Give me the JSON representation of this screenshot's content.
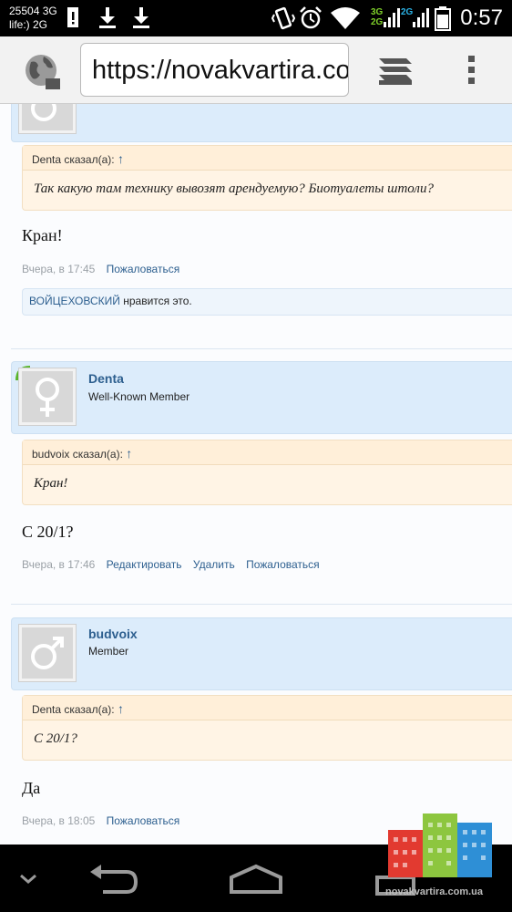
{
  "status_bar": {
    "carrier_line1": "25504 3G",
    "carrier_line2": "life:) 2G",
    "network_badges": [
      "3G",
      "2G",
      "2G"
    ],
    "time": "0:57"
  },
  "browser": {
    "url": "https://novakvartira.com/threads/"
  },
  "posts": [
    {
      "quote_author": "Denta сказал(а):",
      "quote_arrow": "↑",
      "quote_text": "Так какую там технику вывозят арендуемую? Биотуалеты штоли?",
      "message": "Кран!",
      "time": "Вчера, в 17:45",
      "actions": [
        "Пожаловаться"
      ],
      "likes_user": "ВОЙЦЕХОВСКИЙ",
      "likes_text": " нравится это."
    },
    {
      "username": "Denta",
      "user_title": "Well-Known Member",
      "gender_icon": "female-symbol-icon",
      "quote_author": "budvoix сказал(а):",
      "quote_arrow": "↑",
      "quote_text": "Кран!",
      "message": "С 20/1?",
      "time": "Вчера, в 17:46",
      "actions": [
        "Редактировать",
        "Удалить",
        "Пожаловаться"
      ]
    },
    {
      "username": "budvoix",
      "user_title": "Member",
      "gender_icon": "male-symbol-icon",
      "quote_author": "Denta сказал(а):",
      "quote_arrow": "↑",
      "quote_text": "С 20/1?",
      "message": "Да",
      "time": "Вчера, в 18:05",
      "actions": [
        "Пожаловаться"
      ]
    }
  ],
  "watermark": {
    "text": "novakvartira.com.ua"
  },
  "colors": {
    "link": "#2d5f8f",
    "user_row": "#dcecfb",
    "quote_bg": "#fff4e5",
    "online_marker": "#5ab52a"
  }
}
